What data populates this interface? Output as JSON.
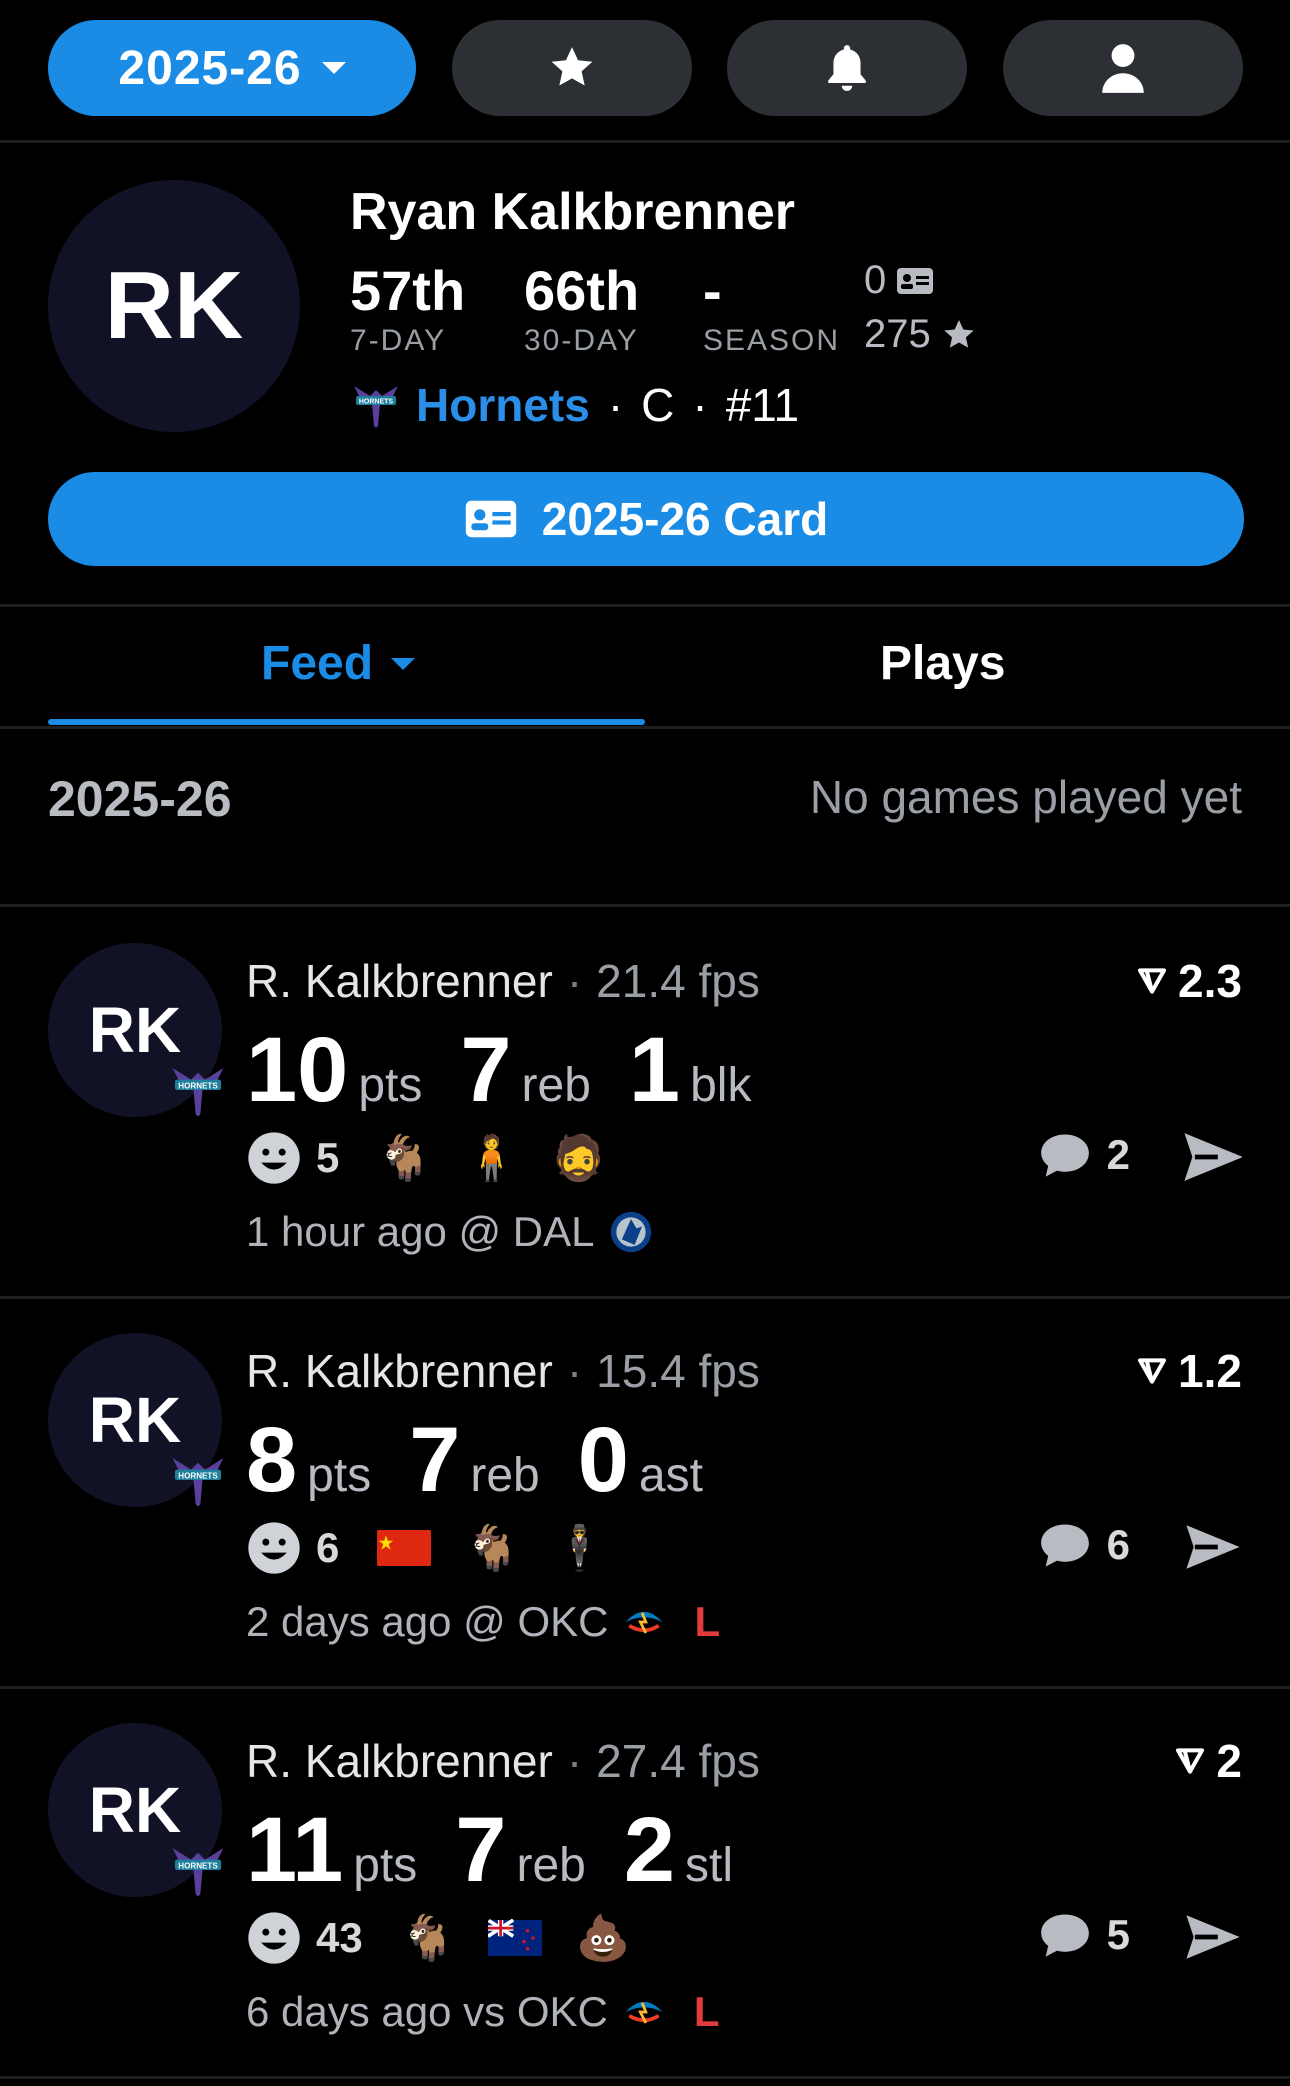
{
  "topbar": {
    "season": "2025-26"
  },
  "player": {
    "initials": "RK",
    "name": "Ryan Kalkbrenner",
    "ranks": [
      {
        "value": "57th",
        "label": "7-DAY"
      },
      {
        "value": "66th",
        "label": "30-DAY"
      },
      {
        "value": "-",
        "label": "SEASON"
      }
    ],
    "cards_count": "0",
    "stars_count": "275",
    "team": "Hornets",
    "position": "C",
    "number": "#11",
    "card_button": "2025-26 Card"
  },
  "tabs": {
    "feed": "Feed",
    "plays": "Plays"
  },
  "season_row": {
    "year": "2025-26",
    "message": "No games played yet"
  },
  "feed": [
    {
      "initials": "RK",
      "name": "R. Kalkbrenner",
      "fps": "21.4 fps",
      "score": "2.3",
      "stats": [
        {
          "num": "10",
          "unit": "pts"
        },
        {
          "num": "7",
          "unit": "reb"
        },
        {
          "num": "1",
          "unit": "blk"
        }
      ],
      "reaction_count": "5",
      "comments": "2",
      "meta": "1 hour ago @ DAL",
      "result": ""
    },
    {
      "initials": "RK",
      "name": "R. Kalkbrenner",
      "fps": "15.4 fps",
      "score": "1.2",
      "stats": [
        {
          "num": "8",
          "unit": "pts"
        },
        {
          "num": "7",
          "unit": "reb"
        },
        {
          "num": "0",
          "unit": "ast"
        }
      ],
      "reaction_count": "6",
      "comments": "6",
      "meta": "2 days ago @ OKC",
      "result": "L"
    },
    {
      "initials": "RK",
      "name": "R. Kalkbrenner",
      "fps": "27.4 fps",
      "score": "2",
      "stats": [
        {
          "num": "11",
          "unit": "pts"
        },
        {
          "num": "7",
          "unit": "reb"
        },
        {
          "num": "2",
          "unit": "stl"
        }
      ],
      "reaction_count": "43",
      "comments": "5",
      "meta": "6 days ago vs OKC",
      "result": "L"
    }
  ],
  "colors": {
    "accent": "#1a8ce6",
    "loss": "#e23b3b",
    "pill": "#2c2f33",
    "avatar": "#121227"
  }
}
